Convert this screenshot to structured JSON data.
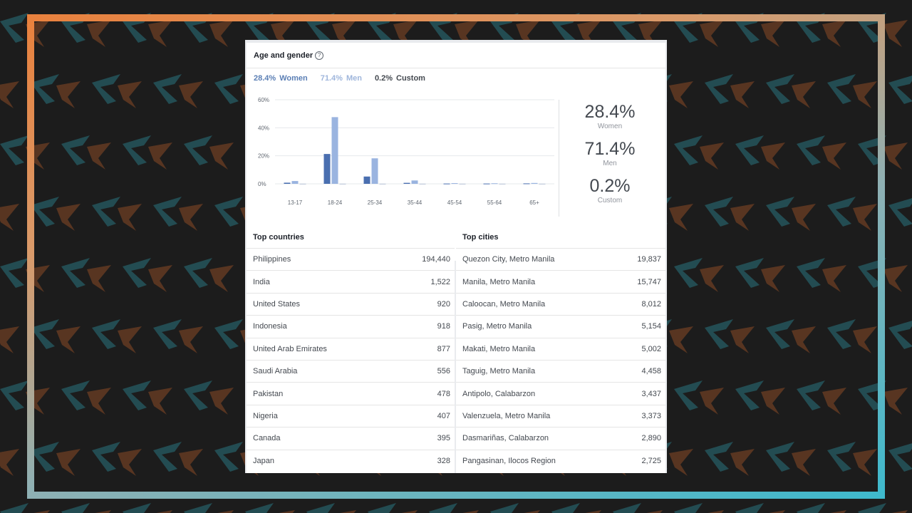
{
  "card": {
    "title": "Age and gender",
    "help_icon": "?"
  },
  "legend": {
    "women_pct": "28.4%",
    "women_label": "Women",
    "men_pct": "71.4%",
    "men_label": "Men",
    "custom_pct": "0.2%",
    "custom_label": "Custom"
  },
  "summary": [
    {
      "value": "28.4%",
      "label": "Women"
    },
    {
      "value": "71.4%",
      "label": "Men"
    },
    {
      "value": "0.2%",
      "label": "Custom"
    }
  ],
  "colors": {
    "women": "#4a6fb0",
    "men": "#9ab4e0",
    "custom": "#b7c3d6",
    "grid": "#e6e8eb"
  },
  "chart_data": {
    "type": "bar",
    "categories": [
      "13-17",
      "18-24",
      "25-34",
      "35-44",
      "45-54",
      "55-64",
      "65+"
    ],
    "series": [
      {
        "name": "Women",
        "values": [
          0.8,
          21.3,
          5.2,
          0.7,
          0.2,
          0.2,
          0.3
        ]
      },
      {
        "name": "Men",
        "values": [
          2.0,
          47.6,
          18.2,
          2.4,
          0.5,
          0.4,
          0.6
        ]
      },
      {
        "name": "Custom",
        "values": [
          0.1,
          0.1,
          0.1,
          0.1,
          0.1,
          0.1,
          0.1
        ]
      }
    ],
    "yticks": [
      "60%",
      "40%",
      "20%",
      "0%"
    ],
    "ytick_values": [
      60,
      40,
      20,
      0
    ],
    "ylim": [
      0,
      60
    ],
    "grid": true
  },
  "countries": {
    "header": "Top countries",
    "rows": [
      {
        "name": "Philippines",
        "value": "194,440"
      },
      {
        "name": "India",
        "value": "1,522"
      },
      {
        "name": "United States",
        "value": "920"
      },
      {
        "name": "Indonesia",
        "value": "918"
      },
      {
        "name": "United Arab Emirates",
        "value": "877"
      },
      {
        "name": "Saudi Arabia",
        "value": "556"
      },
      {
        "name": "Pakistan",
        "value": "478"
      },
      {
        "name": "Nigeria",
        "value": "407"
      },
      {
        "name": "Canada",
        "value": "395"
      },
      {
        "name": "Japan",
        "value": "328"
      }
    ]
  },
  "cities": {
    "header": "Top cities",
    "rows": [
      {
        "name": "Quezon City, Metro Manila",
        "value": "19,837"
      },
      {
        "name": "Manila, Metro Manila",
        "value": "15,747"
      },
      {
        "name": "Caloocan, Metro Manila",
        "value": "8,012"
      },
      {
        "name": "Pasig, Metro Manila",
        "value": "5,154"
      },
      {
        "name": "Makati, Metro Manila",
        "value": "5,002"
      },
      {
        "name": "Taguig, Metro Manila",
        "value": "4,458"
      },
      {
        "name": "Antipolo, Calabarzon",
        "value": "3,437"
      },
      {
        "name": "Valenzuela, Metro Manila",
        "value": "3,373"
      },
      {
        "name": "Dasmariñas, Calabarzon",
        "value": "2,890"
      },
      {
        "name": "Pangasinan, Ilocos Region",
        "value": "2,725"
      }
    ]
  }
}
